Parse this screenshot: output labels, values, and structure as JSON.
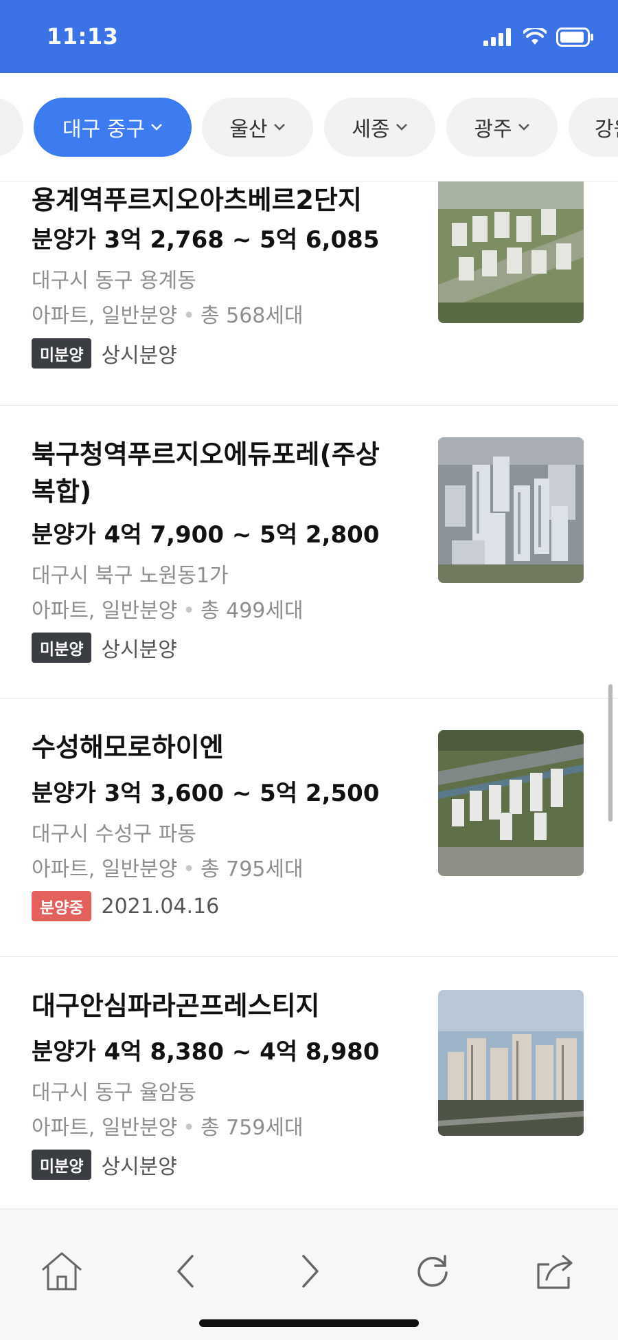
{
  "status_bar": {
    "time": "11:13"
  },
  "region_chips": [
    {
      "label": "대구 중구",
      "active": true
    },
    {
      "label": "울산",
      "active": false
    },
    {
      "label": "세종",
      "active": false
    },
    {
      "label": "광주",
      "active": false
    },
    {
      "label": "강원",
      "active": false
    }
  ],
  "listings": [
    {
      "title": "용계역푸르지오아츠베르2단지",
      "price": "분양가 3억 2,768 ~ 5억 6,085",
      "address": "대구시 동구 용계동",
      "type": "아파트, 일반분양",
      "units": "총 568세대",
      "badge": "미분양",
      "status": "상시분양"
    },
    {
      "title": "북구청역푸르지오에듀포레(주상복합)",
      "price": "분양가 4억 7,900 ~ 5억 2,800",
      "address": "대구시 북구 노원동1가",
      "type": "아파트, 일반분양",
      "units": "총 499세대",
      "badge": "미분양",
      "status": "상시분양"
    },
    {
      "title": "수성해모로하이엔",
      "price": "분양가 3억 3,600 ~ 5억 2,500",
      "address": "대구시 수성구 파동",
      "type": "아파트, 일반분양",
      "units": "총 795세대",
      "badge": "분양중",
      "status": "2021.04.16"
    },
    {
      "title": "대구안심파라곤프레스티지",
      "price": "분양가 4억 8,380 ~ 4억 8,980",
      "address": "대구시 동구 율암동",
      "type": "아파트, 일반분양",
      "units": "총 759세대",
      "badge": "미분양",
      "status": "상시분양"
    }
  ],
  "bottom_nav": [
    "home-icon",
    "back-icon",
    "forward-icon",
    "reload-icon",
    "share-icon"
  ],
  "colors": {
    "header": "#3b72e6",
    "chip_active": "#3d7cf0",
    "badge_unsold": "#3a3d42",
    "badge_selling": "#e4605d"
  }
}
